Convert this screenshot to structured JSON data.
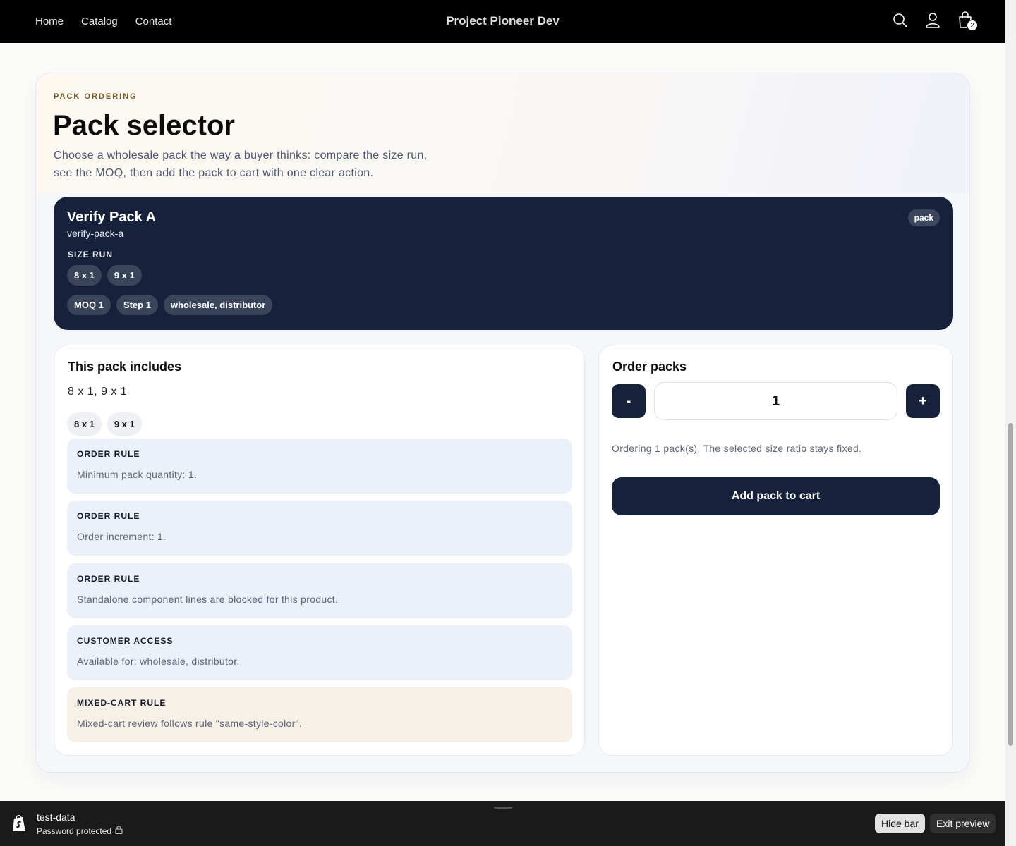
{
  "header": {
    "nav": [
      "Home",
      "Catalog",
      "Contact"
    ],
    "brand": "Project Pioneer Dev",
    "icons": [
      "search-icon",
      "account-icon",
      "cart-icon"
    ],
    "cart_count": "2"
  },
  "hero": {
    "eyebrow": "PACK ORDERING",
    "title": "Pack selector",
    "subtitle": "Choose a wholesale pack the way a buyer thinks: compare the size run, see the MOQ, then add the pack to cart with one clear action."
  },
  "pack": {
    "name": "Verify Pack A",
    "handle": "verify-pack-a",
    "badge": "pack",
    "size_run_label": "SIZE RUN",
    "sizes": [
      "8 x 1",
      "9 x 1"
    ],
    "meta": [
      "MOQ 1",
      "Step 1",
      "wholesale, distributor"
    ]
  },
  "includes": {
    "title": "This pack includes",
    "summary": "8 x 1, 9 x 1",
    "chips": [
      "8 x 1",
      "9 x 1"
    ],
    "rules": [
      {
        "label": "ORDER RULE",
        "text": "Minimum pack quantity: 1."
      },
      {
        "label": "ORDER RULE",
        "text": "Order increment: 1."
      },
      {
        "label": "ORDER RULE",
        "text": "Standalone component lines are blocked for this product."
      },
      {
        "label": "CUSTOMER ACCESS",
        "text": "Available for: wholesale, distributor."
      },
      {
        "label": "MIXED-CART RULE",
        "text": "Mixed-cart review follows rule \"same-style-color\"."
      }
    ]
  },
  "order": {
    "title": "Order packs",
    "minus": "-",
    "plus": "+",
    "quantity": "1",
    "note": "Ordering 1 pack(s). The selected size ratio stays fixed.",
    "add_label": "Add pack to cart"
  },
  "preview_bar": {
    "store": "test-data",
    "status": "Password protected",
    "hide_label": "Hide bar",
    "exit_label": "Exit preview"
  },
  "colors": {
    "navy": "#16223b",
    "eyebrow": "#7a5420",
    "rule_bg": "#ecf0f8",
    "mixed_bg": "#f6f0e6"
  }
}
